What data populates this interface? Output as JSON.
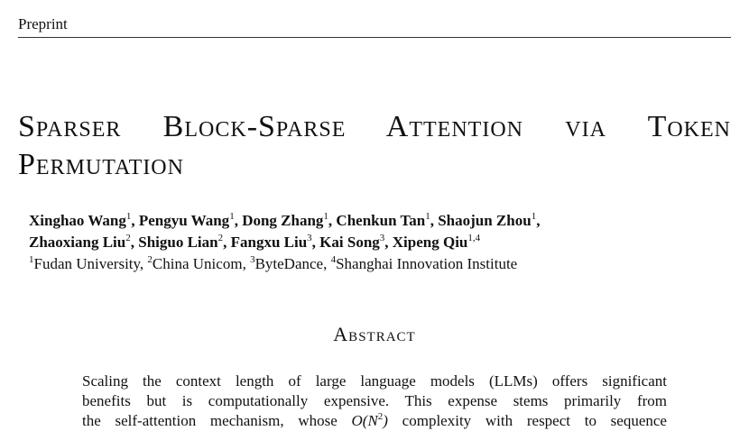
{
  "header": {
    "label": "Preprint"
  },
  "title": {
    "line1": "Sparser Block-Sparse Attention via Token",
    "line2": "Permutation"
  },
  "authors": [
    {
      "name": "Xinghao Wang",
      "aff": "1",
      "sep": ", "
    },
    {
      "name": "Pengyu Wang",
      "aff": "1",
      "sep": ", "
    },
    {
      "name": "Dong Zhang",
      "aff": "1",
      "sep": ", "
    },
    {
      "name": "Chenkun Tan",
      "aff": "1",
      "sep": ", "
    },
    {
      "name": "Shaojun Zhou",
      "aff": "1",
      "sep": ","
    },
    {
      "name": "Zhaoxiang Liu",
      "aff": "2",
      "sep": ", "
    },
    {
      "name": "Shiguo Lian",
      "aff": "2",
      "sep": ", "
    },
    {
      "name": "Fangxu Liu",
      "aff": "3",
      "sep": ", "
    },
    {
      "name": "Kai Song",
      "aff": "3",
      "sep": ", "
    },
    {
      "name": "Xipeng Qiu",
      "aff": "1,4",
      "sep": ""
    }
  ],
  "affiliations": [
    {
      "num": "1",
      "name": "Fudan University",
      "sep": ", "
    },
    {
      "num": "2",
      "name": "China Unicom",
      "sep": ", "
    },
    {
      "num": "3",
      "name": "ByteDance",
      "sep": ", "
    },
    {
      "num": "4",
      "name": "Shanghai Innovation Institute",
      "sep": ""
    }
  ],
  "abstract": {
    "heading": "Abstract",
    "line1": "Scaling the context length of large language models (LLMs) offers significant",
    "line2": "benefits but is computationally expensive.  This expense stems primarily from",
    "line3_pre": "the self-attention mechanism, whose ",
    "line3_math": "O(N",
    "line3_math_sup": "2",
    "line3_math_close": ")",
    "line3_post": " complexity with respect to sequence"
  }
}
